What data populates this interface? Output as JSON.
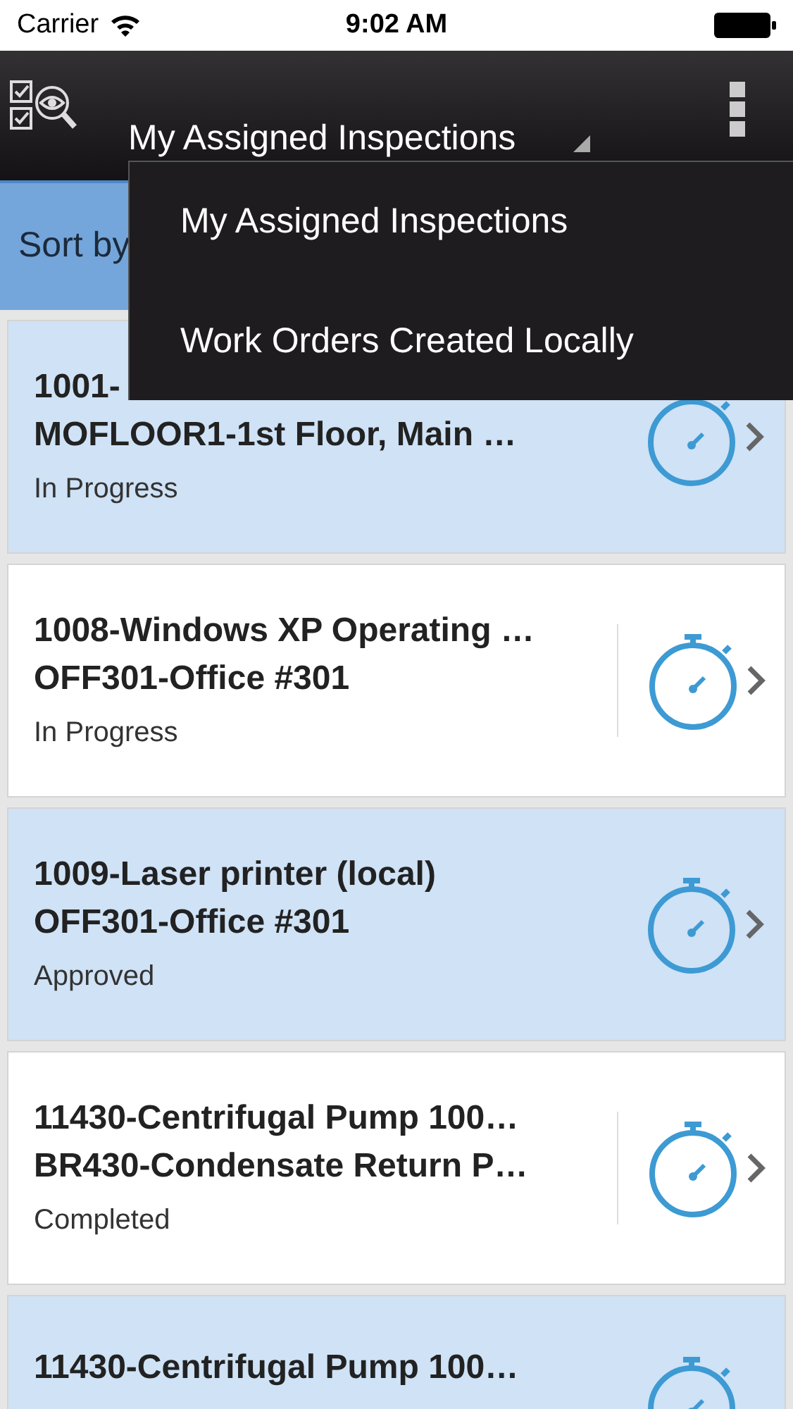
{
  "status_bar": {
    "carrier": "Carrier",
    "time": "9:02 AM"
  },
  "nav_bar": {
    "title": "My Assigned Inspections"
  },
  "sort_bar": {
    "label": "Sort by"
  },
  "dropdown": {
    "items": [
      {
        "label": "My Assigned Inspections"
      },
      {
        "label": "Work Orders Created Locally"
      }
    ]
  },
  "records": [
    {
      "title": "1001-",
      "location": "MOFLOOR1-1st Floor, Main …",
      "status": "In Progress",
      "highlighted": true
    },
    {
      "title": "1008-Windows XP Operating …",
      "location": "OFF301-Office #301",
      "status": "In Progress",
      "highlighted": false
    },
    {
      "title": "1009-Laser printer (local)",
      "location": "OFF301-Office #301",
      "status": "Approved",
      "highlighted": true
    },
    {
      "title": "11430-Centrifugal Pump 100…",
      "location": "BR430-Condensate Return P…",
      "status": "Completed",
      "highlighted": false
    },
    {
      "title": "11430-Centrifugal Pump 100…",
      "highlighted": true
    }
  ]
}
